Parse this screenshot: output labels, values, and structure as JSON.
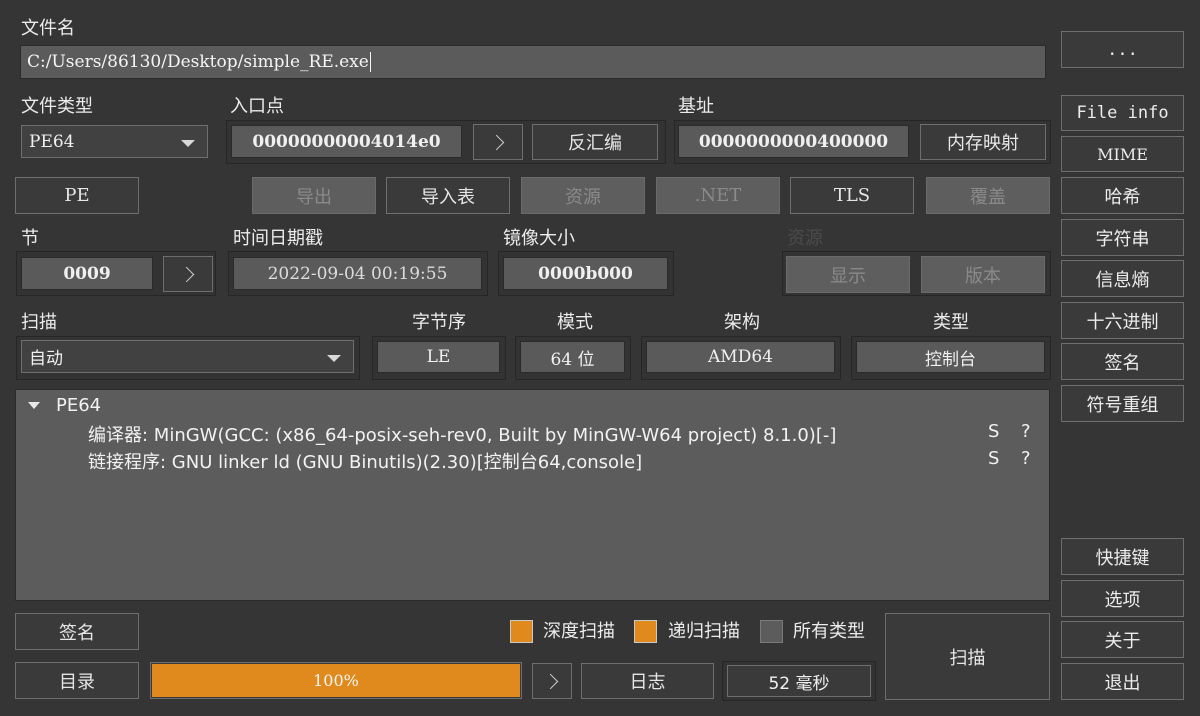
{
  "file": {
    "label": "文件名",
    "path": "C:/Users/86130/Desktop/simple_RE.exe",
    "browse_label": "..."
  },
  "file_type": {
    "label": "文件类型",
    "value": "PE64"
  },
  "entry_point": {
    "label": "入口点",
    "value": "00000000004014e0",
    "go_label": ">",
    "disasm_label": "反汇编"
  },
  "base_address": {
    "label": "基址",
    "value": "0000000000400000",
    "memmap_label": "内存映射"
  },
  "pe_row": {
    "pe": "PE",
    "export": "导出",
    "import": "导入表",
    "resources": "资源",
    "dotnet": ".NET",
    "tls": "TLS",
    "overlay": "覆盖"
  },
  "sections": {
    "label": "节",
    "value": "0009",
    "go_label": ">"
  },
  "timestamp": {
    "label": "时间日期戳",
    "value": "2022-09-04 00:19:55"
  },
  "image_size": {
    "label": "镜像大小",
    "value": "0000b000"
  },
  "resources_group": {
    "label": "资源",
    "show": "显示",
    "version": "版本"
  },
  "scan_row": {
    "scan_label": "扫描",
    "scan_mode": "自动",
    "endianness_label": "字节序",
    "endianness": "LE",
    "mode_label": "模式",
    "mode": "64 位",
    "arch_label": "架构",
    "arch": "AMD64",
    "type_label": "类型",
    "type": "控制台"
  },
  "results": {
    "root": "PE64",
    "entries": [
      {
        "text": "编译器: MinGW(GCC: (x86_64-posix-seh-rev0, Built by MinGW-W64 project) 8.1.0)[-]",
        "s": "S",
        "q": "?"
      },
      {
        "text": "链接程序: GNU linker ld (GNU Binutils)(2.30)[控制台64,console]",
        "s": "S",
        "q": "?"
      }
    ]
  },
  "sidebar": {
    "file_info": "File info",
    "mime": "MIME",
    "hash": "哈希",
    "strings": "字符串",
    "entropy": "信息熵",
    "hex": "十六进制",
    "signature": "签名",
    "demangle": "符号重组",
    "shortcuts": "快捷键",
    "options": "选项",
    "about": "关于",
    "exit": "退出"
  },
  "bottom": {
    "signatures": "签名",
    "directory": "目录",
    "deep_scan": {
      "label": "深度扫描",
      "checked": true
    },
    "recursive_scan": {
      "label": "递归扫描",
      "checked": true
    },
    "all_types": {
      "label": "所有类型",
      "checked": false
    },
    "progress": "100%",
    "progress_value": 1.0,
    "go_label": ">",
    "log": "日志",
    "elapsed": "52 毫秒",
    "scan": "扫描"
  },
  "colors": {
    "accent": "#e08a1e",
    "background": "#353535",
    "panel": "#5a5a5a"
  }
}
